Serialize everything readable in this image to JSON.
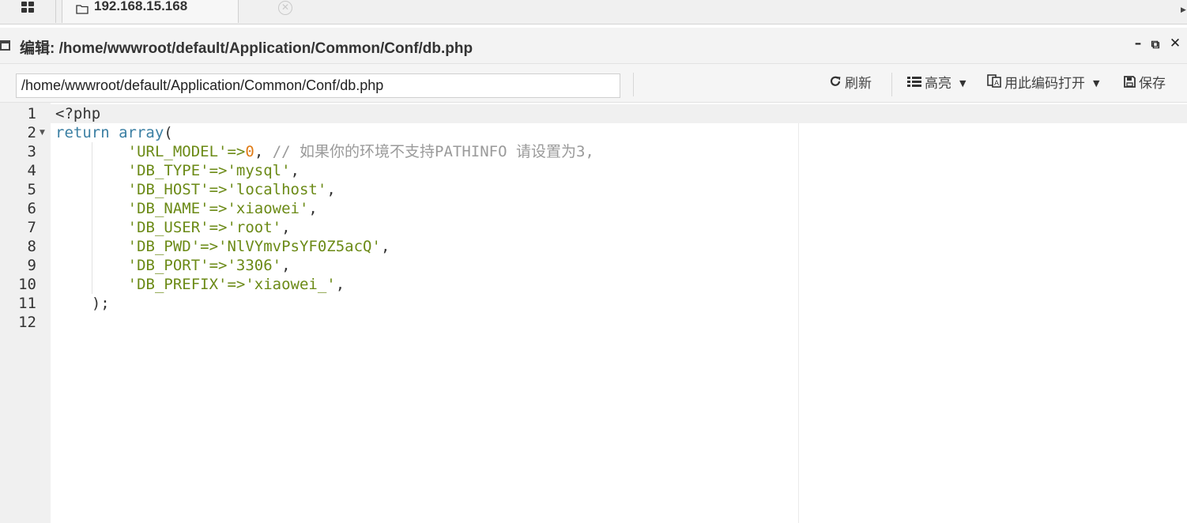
{
  "tabs": [
    {
      "label": "192.168.15.168",
      "icon": "folder-icon",
      "closable": true
    }
  ],
  "window": {
    "title_prefix": "编辑:",
    "title_path": "/home/wwwroot/default/Application/Common/Conf/db.php",
    "buttons": {
      "minimize": "–",
      "restore": "⧉",
      "close": "✕"
    }
  },
  "toolbar": {
    "path_value": "/home/wwwroot/default/Application/Common/Conf/db.php",
    "refresh_label": "刷新",
    "highlight_label": "高亮",
    "encoding_label": "用此编码打开",
    "save_label": "保存"
  },
  "editor": {
    "line_numbers": [
      "1",
      "2",
      "3",
      "4",
      "5",
      "6",
      "7",
      "8",
      "9",
      "10",
      "11",
      "12"
    ],
    "active_line": 1,
    "fold_line": 2,
    "lines": [
      "<?php",
      "return array(",
      "        'URL_MODEL'=>0, // 如果你的环境不支持PATHINFO 请设置为3,",
      "        'DB_TYPE'=>'mysql',",
      "        'DB_HOST'=>'localhost',",
      "        'DB_NAME'=>'xiaowei',",
      "        'DB_USER'=>'root',",
      "        'DB_PWD'=>'NlVYmvPsYF0Z5acQ',",
      "        'DB_PORT'=>'3306',",
      "        'DB_PREFIX'=>'xiaowei_',",
      "    );",
      ""
    ]
  },
  "colors": {
    "keyword": "#3b7fa3",
    "string": "#6b8a16",
    "number": "#e07b16",
    "comment": "#9a9a9a",
    "gutter": "#f0f0f0"
  }
}
